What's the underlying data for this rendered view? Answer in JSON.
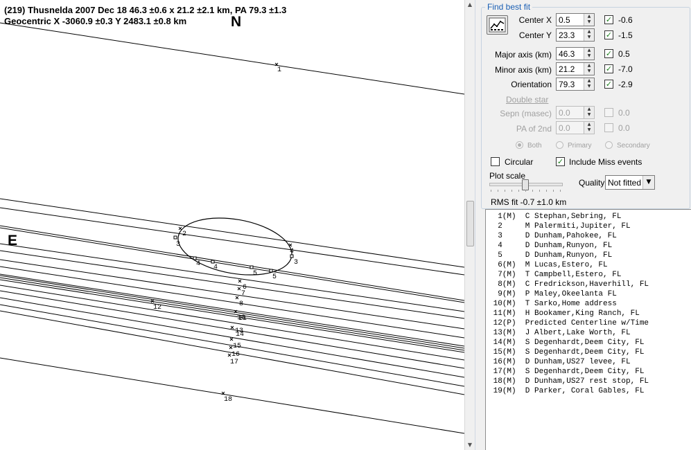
{
  "plot": {
    "header_line1": "(219) Thusnelda  2007 Dec 18  46.3 ±0.6 x 21.2 ±2.1 km, PA 79.3 ±1.3",
    "header_line2": "Geocentric  X  -3060.9 ±0.3  Y 2483.1 ±0.8 km",
    "north_label": "N",
    "east_label": "E",
    "chord_labels": [
      "1",
      "2",
      "3",
      "4",
      "4",
      "5",
      "5",
      "4",
      "3",
      "6",
      "7",
      "8",
      "10",
      "11",
      "12",
      "13",
      "14",
      "15",
      "16",
      "17",
      "18"
    ]
  },
  "panel": {
    "group_title": "Find best fit",
    "fit_button_icon": "chart-fit-icon",
    "params": [
      {
        "label": "Center X",
        "value": "0.5",
        "checked": true,
        "residual": "-0.6"
      },
      {
        "label": "Center Y",
        "value": "23.3",
        "checked": true,
        "residual": "-1.5"
      },
      {
        "label": "Major axis (km)",
        "value": "46.3",
        "checked": true,
        "residual": "0.5"
      },
      {
        "label": "Minor axis (km)",
        "value": "21.2",
        "checked": true,
        "residual": "-7.0"
      },
      {
        "label": "Orientation",
        "value": "79.3",
        "checked": true,
        "residual": "-2.9"
      }
    ],
    "double_star_link": "Double star",
    "double": [
      {
        "label": "Sepn (masec)",
        "value": "0.0",
        "checked": false,
        "residual": "0.0"
      },
      {
        "label": "PA of 2nd",
        "value": "0.0",
        "checked": false,
        "residual": "0.0"
      }
    ],
    "radios": [
      "Both",
      "Primary",
      "Secondary"
    ],
    "circular_label": "Circular",
    "circular_checked": false,
    "include_miss_label": "Include Miss events",
    "include_miss_checked": true,
    "plot_scale_label": "Plot scale",
    "quality_label": "Quality",
    "quality_value": "Not fitted",
    "rms_text": "RMS fit -0.7 ±1.0 km",
    "check_mark": "✓",
    "accent_color": "#1a5fb4"
  },
  "events": [
    "  1(M)  C Stephan,Sebring, FL",
    "  2     M Palermiti,Jupiter, FL",
    "  3     D Dunham,Pahokee, FL",
    "  4     D Dunham,Runyon, FL",
    "  5     D Dunham,Runyon, FL",
    "  6(M)  M Lucas,Estero, FL",
    "  7(M)  T Campbell,Estero, FL",
    "  8(M)  C Fredrickson,Haverhill, FL",
    "  9(M)  P Maley,Okeelanta FL",
    " 10(M)  T Sarko,Home address",
    " 11(M)  H Bookamer,King Ranch, FL",
    " 12(P)  Predicted Centerline w/Time",
    " 13(M)  J Albert,Lake Worth, FL",
    " 14(M)  S Degenhardt,Deem City, FL",
    " 15(M)  S Degenhardt,Deem City, FL",
    " 16(M)  D Dunham,US27 levee, FL",
    " 17(M)  S Degenhardt,Deem City, FL",
    " 18(M)  D Dunham,US27 rest stop, FL",
    " 19(M)  D Parker, Coral Gables, FL"
  ]
}
